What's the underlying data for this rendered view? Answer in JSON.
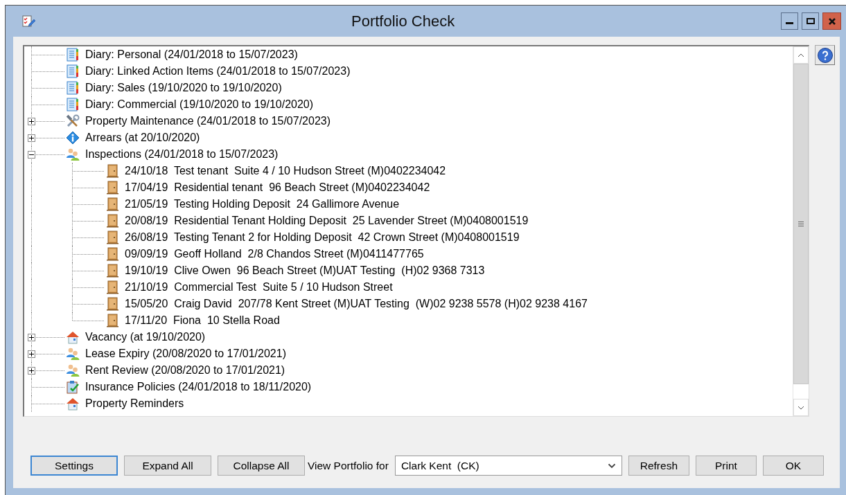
{
  "window": {
    "title": "Portfolio Check"
  },
  "tree": [
    {
      "kind": "diary",
      "label": "Diary: Personal (24/01/2018 to 15/07/2023)"
    },
    {
      "kind": "diary",
      "label": "Diary: Linked Action Items (24/01/2018 to 15/07/2023)"
    },
    {
      "kind": "diary",
      "label": "Diary: Sales (19/10/2020 to 19/10/2020)"
    },
    {
      "kind": "diary",
      "label": "Diary: Commercial (19/10/2020 to 19/10/2020)"
    },
    {
      "kind": "tools",
      "label": "Property Maintenance (24/01/2018 to 15/07/2023)",
      "expanded": false
    },
    {
      "kind": "info",
      "label": "Arrears (at 20/10/2020)",
      "expanded": false
    },
    {
      "kind": "people",
      "label": "Inspections (24/01/2018 to 15/07/2023)",
      "expanded": true,
      "children": [
        {
          "kind": "door",
          "label": "24/10/18  Test tenant  Suite 4 / 10 Hudson Street (M)0402234042"
        },
        {
          "kind": "door",
          "label": "17/04/19  Residential tenant  96 Beach Street (M)0402234042"
        },
        {
          "kind": "door",
          "label": "21/05/19  Testing Holding Deposit  24 Gallimore Avenue"
        },
        {
          "kind": "door",
          "label": "20/08/19  Residential Tenant Holding Deposit  25 Lavender Street (M)0408001519"
        },
        {
          "kind": "door",
          "label": "26/08/19  Testing Tenant 2 for Holding Deposit  42 Crown Street (M)0408001519"
        },
        {
          "kind": "door",
          "label": "09/09/19  Geoff Holland  2/8 Chandos Street (M)0411477765"
        },
        {
          "kind": "door",
          "label": "19/10/19  Clive Owen  96 Beach Street (M)UAT Testing  (H)02 9368 7313"
        },
        {
          "kind": "door",
          "label": "21/10/19  Commercial Test  Suite 5 / 10 Hudson Street"
        },
        {
          "kind": "door",
          "label": "15/05/20  Craig David  207/78 Kent Street (M)UAT Testing  (W)02 9238 5578 (H)02 9238 4167"
        },
        {
          "kind": "door",
          "label": "17/11/20  Fiona  10 Stella Road"
        }
      ]
    },
    {
      "kind": "house",
      "label": "Vacancy (at 19/10/2020)",
      "expanded": false
    },
    {
      "kind": "people",
      "label": "Lease Expiry (20/08/2020 to 17/01/2021)",
      "expanded": false
    },
    {
      "kind": "people",
      "label": "Rent Review (20/08/2020 to 17/01/2021)",
      "expanded": false
    },
    {
      "kind": "clipboard",
      "label": "Insurance Policies (24/01/2018 to 18/11/2020)"
    },
    {
      "kind": "house",
      "label": "Property Reminders"
    }
  ],
  "footer": {
    "buttons_left": [
      {
        "label": "Settings",
        "focused": true
      },
      {
        "label": "Expand All",
        "focused": false
      },
      {
        "label": "Collapse All",
        "focused": false
      }
    ],
    "view_portfolio_label": "View Portfolio for",
    "view_portfolio_value": "Clark Kent  (CK)",
    "buttons_right": [
      {
        "label": "Refresh",
        "focused": false
      },
      {
        "label": "Print",
        "focused": false
      },
      {
        "label": "OK",
        "focused": false
      }
    ]
  }
}
